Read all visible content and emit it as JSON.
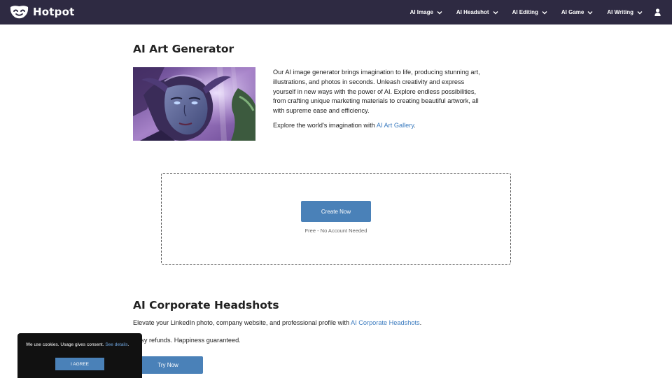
{
  "header": {
    "brand": "Hotpot",
    "nav": [
      {
        "label": "AI Image",
        "icon": "chevron-down-icon"
      },
      {
        "label": "AI Headshot",
        "icon": "chevron-down-icon"
      },
      {
        "label": "AI Editing",
        "icon": "chevron-down-icon"
      },
      {
        "label": "AI Game",
        "icon": "chevron-down-icon"
      },
      {
        "label": "AI Writing",
        "icon": "chevron-down-icon"
      }
    ],
    "user_icon": "user-icon"
  },
  "generator": {
    "title": "AI Art Generator",
    "description": "Our AI image generator brings imagination to life, producing stunning art, illustrations, and photos in seconds. Unleash creativity and express yourself in new ways with the power of AI. Explore endless possibilities, from crafting unique marketing materials to creating beautiful artwork, all with supreme ease and efficiency.",
    "explore_prefix": "Explore the world's imagination with ",
    "explore_link": "AI Art Gallery",
    "explore_suffix": ".",
    "create_button": "Create Now",
    "free_note": "Free - No Account Needed"
  },
  "headshots": {
    "title": "AI Corporate Headshots",
    "text_prefix": "Elevate your LinkedIn photo, company website, and professional profile with ",
    "text_link": "AI Corporate Headshots",
    "text_suffix": ".",
    "refund_text": "Easy refunds. Happiness guaranteed.",
    "try_button": "Try Now"
  },
  "cookie_banner": {
    "text": "We use cookies. Usage gives consent. ",
    "link": "See details",
    "link_suffix": ".",
    "agree_button": "I AGREE"
  },
  "colors": {
    "header_bg": "#2e2a42",
    "accent": "#4a81b8",
    "link": "#3b7bbf"
  }
}
